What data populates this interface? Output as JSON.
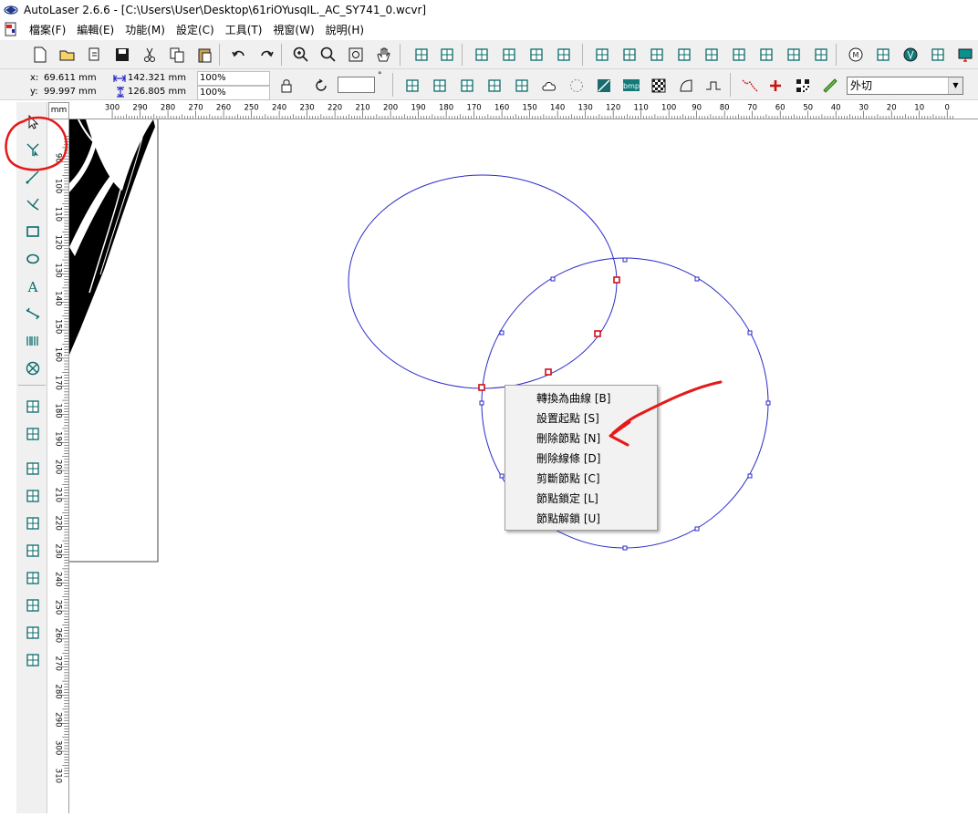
{
  "window": {
    "title": "AutoLaser 2.6.6 - [C:\\Users\\User\\Desktop\\61riOYusqIL._AC_SY741_0.wcvr]"
  },
  "menu": [
    "檔案(F)",
    "編輯(E)",
    "功能(M)",
    "設定(C)",
    "工具(T)",
    "視窗(W)",
    "說明(H)"
  ],
  "status": {
    "x_label": "x:",
    "x_value": "69.611 mm",
    "y_label": "y:",
    "y_value": "99.997 mm",
    "width_value": "142.321 mm",
    "height_value": "126.805 mm",
    "ratio_w": "100%",
    "ratio_h": "100%"
  },
  "toolbar2": {
    "bmp_label": "bmp",
    "cut_mode": "外切",
    "degree_symbol": "°"
  },
  "ruler": {
    "unit": "mm",
    "h_ticks": [
      "300",
      "290",
      "280",
      "270",
      "260",
      "250",
      "240",
      "230",
      "220",
      "210",
      "200",
      "190",
      "180",
      "170",
      "160",
      "150",
      "140",
      "130",
      "120",
      "110",
      "100",
      "90",
      "80",
      "70",
      "60",
      "50",
      "40",
      "30",
      "20",
      "10",
      "0"
    ],
    "v_ticks": [
      "90",
      "100",
      "110",
      "120",
      "130",
      "140",
      "150",
      "160",
      "170",
      "180",
      "190",
      "200",
      "210",
      "220",
      "230",
      "240",
      "250",
      "260",
      "270",
      "280",
      "290",
      "300",
      "310"
    ]
  },
  "context_menu": {
    "items": [
      "轉換為曲線 [B]",
      "設置起點 [S]",
      "刪除節點 [N]",
      "刪除線條 [D]",
      "剪斷節點 [C]",
      "節點鎖定 [L]",
      "節點解鎖 [U]"
    ]
  },
  "colors": {
    "curve": "#2a2ac8",
    "selected_node": "#d0101a",
    "annotation": "#e51919",
    "toolbar_bg": "#f0f0f0"
  },
  "icons": {
    "toolbar1": [
      "new-file-icon",
      "open-folder-icon",
      "import-icon",
      "save-icon",
      "cut-icon",
      "copy-icon",
      "paste-icon",
      "undo-icon",
      "redo-icon",
      "zoom-in-icon",
      "zoom-select-icon",
      "zoom-fit-icon",
      "pan-hand-icon",
      "group-icon",
      "ungroup-icon",
      "node-connect-icon",
      "frame-icon",
      "grid-icon",
      "layer-icon",
      "align-top-icon",
      "align-middle-icon",
      "align-center-icon",
      "align-left-icon",
      "align-right-icon",
      "size-icon",
      "expand-icon",
      "shrink-icon",
      "resize-icon",
      "machine-icon",
      "list-icon",
      "brand-icon",
      "bounding-icon",
      "monitor-icon"
    ],
    "toolbar2": [
      "lock-icon",
      "rotate-icon",
      "distribute-h-icon",
      "distribute-v-icon",
      "flip-icon",
      "mirror-icon",
      "spacing-icon",
      "cloud-icon",
      "circle-dash-icon",
      "image-icon",
      "bmp-icon",
      "checker-icon",
      "curve-tool-icon",
      "pulse-icon",
      "zigzag-icon",
      "cross-icon",
      "qr-code-icon",
      "ruler-icon"
    ],
    "left": [
      "pointer-icon",
      "node-edit-icon",
      "line-icon",
      "polyline-icon",
      "rectangle-icon",
      "ellipse-icon",
      "text-icon",
      "measure-icon",
      "barcode-icon",
      "circle-cross-icon",
      "mirror-h-icon",
      "mirror-v-icon",
      "align-left-tool-icon",
      "center-h-icon",
      "align-right-tool-icon",
      "align-top-tool-icon",
      "center-v-icon",
      "align-bottom-tool-icon",
      "same-width-icon",
      "same-height-icon"
    ]
  }
}
